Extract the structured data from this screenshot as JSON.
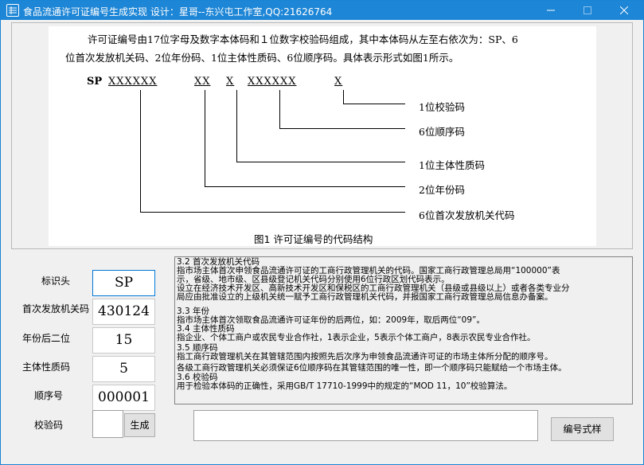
{
  "window": {
    "title": "食品流通许可证编号生成实现 设计：星哥--东兴屯工作室,QQ:21626764"
  },
  "figure": {
    "intro_line1": "许可证编号由17位字母及数字本体码和１位数字校验码组成，其中本体码从左至右依次为：SP、6",
    "intro_line2": "位首次发放机关码、2位年份码、1位主体性质码、6位顺序码。具体表示形式如图1所示。",
    "code_sp": "SP",
    "code_authority": "XXXXXX",
    "code_year": "XX",
    "code_nature": "X",
    "code_sequence": "XXXXXX",
    "code_check": "X",
    "callout_check": "1位校验码",
    "callout_sequence": "6位顺序码",
    "callout_nature": "1位主体性质码",
    "callout_year": "2位年份码",
    "callout_authority": "6位首次发放机关代码",
    "caption": "图1 许可证编号的代码结构"
  },
  "form": {
    "label_prefix": "标识头",
    "value_prefix": "SP",
    "label_authority": "首次发放机关码",
    "value_authority": "430124",
    "label_year": "年份后二位",
    "value_year": "15",
    "label_nature": "主体性质码",
    "value_nature": "5",
    "label_sequence": "顺序号",
    "value_sequence": "000001",
    "label_check": "校验码",
    "value_check": "",
    "generate_button": "生成",
    "format_button": "编号式样",
    "result_value": ""
  },
  "description": [
    "3.2 首次发放机关代码",
    "指市场主体首次申领食品流通许可证的工商行政管理机关的代码。国家工商行政管理总局用“100000”表",
    "示，省级、地市级、区县级登记机关代码分别使用6位行政区划代码表示。",
    "设立在经济技术开发区、高新技术开发区和保税区的工商行政管理机关（县级或县级以上）或者各类专业分",
    "局应由批准设立的上级机关统一赋予工商行政管理机关代码，并报国家工商行政管理总局信息办备案。",
    "3.3 年份",
    "指市场主体首次领取食品流通许可证年份的后两位，如：2009年，取后两位“09”。",
    "3.4 主体性质码",
    "指企业、个体工商户或农民专业合作社，1表示企业，5表示个体工商户，8表示农民专业合作社。",
    "3.5 顺序码",
    "指工商行政管理机关在其管辖范围内按照先后次序为申领食品流通许可证的市场主体所分配的顺序号。",
    "各级工商行政管理机关必须保证6位顺序码在其管辖范围的唯一性，即一个顺序码只能赋给一个市场主体。",
    "3.6 校验码",
    "        用于检验本体码的正确性，采用GB/T 17710-1999中的规定的“MOD 11，10”校验算法。"
  ]
}
